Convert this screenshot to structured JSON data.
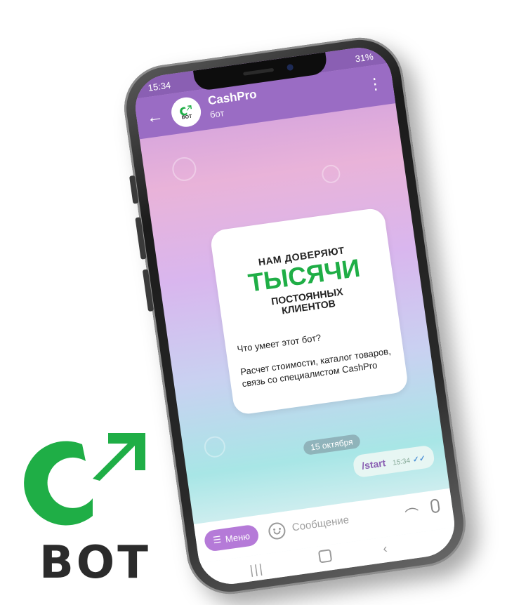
{
  "status": {
    "time": "15:34",
    "battery": "31%"
  },
  "chat": {
    "title": "CashPro",
    "subtitle": "бот",
    "avatar_caption": "BOT"
  },
  "card": {
    "line1": "НАМ ДОВЕРЯЮТ",
    "line2": "ТЫСЯЧИ",
    "line3a": "ПОСТОЯННЫХ",
    "line3b": "КЛИЕНТОВ",
    "question": "Что умеет этот бот?",
    "answer": "Расчет стоимости, каталог товаров, связь со специалистом CashPro"
  },
  "date_chip": "15 октября",
  "outgoing": {
    "text": "/start",
    "time": "15:34"
  },
  "composer": {
    "menu_label": "Меню",
    "placeholder": "Сообщение"
  },
  "brand": {
    "label": "BOT"
  },
  "colors": {
    "brand_green": "#1fae46",
    "header": "#9a6cc4"
  }
}
